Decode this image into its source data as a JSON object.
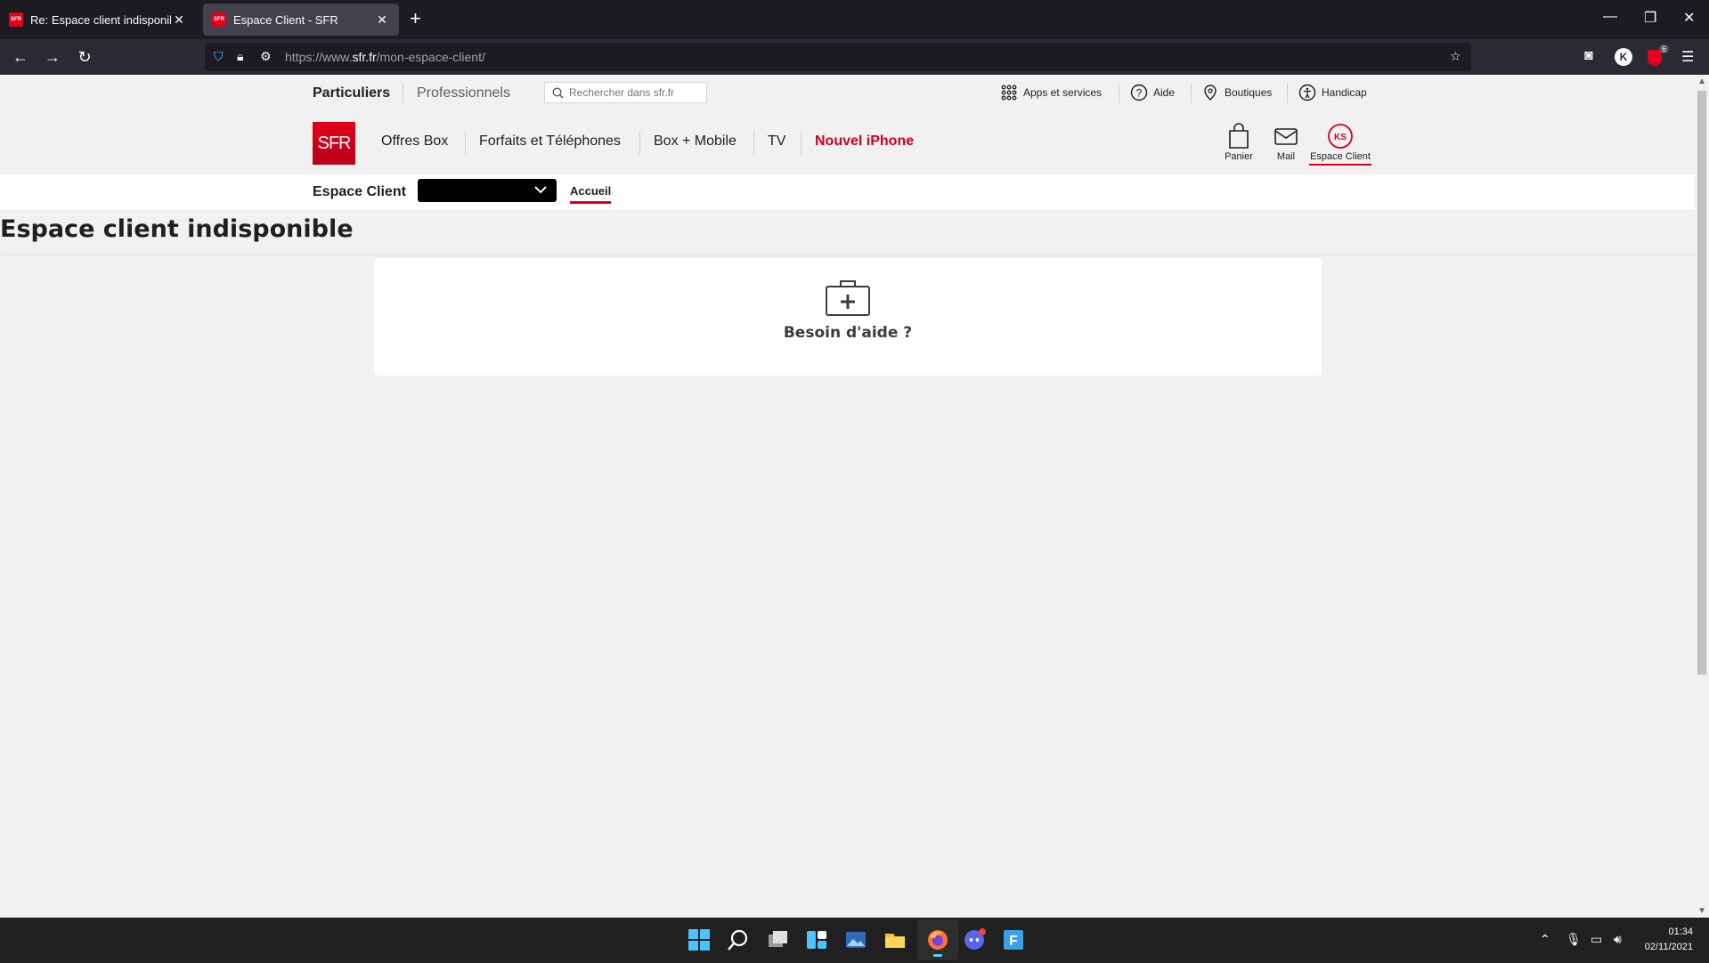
{
  "browser": {
    "tabs": [
      {
        "label": "Re: Espace client indisponible -",
        "favicon": "SFR"
      },
      {
        "label": "Espace Client - SFR",
        "favicon": "SFR"
      }
    ],
    "url_prefix": "https://www.",
    "url_domain": "sfr.fr",
    "url_path": "/mon-espace-client/",
    "profile_initial": "K",
    "extension_badge": "6"
  },
  "sfr": {
    "segments": {
      "particuliers": "Particuliers",
      "professionnels": "Professionnels"
    },
    "search_placeholder": "Rechercher dans sfr.fr",
    "top_links": {
      "apps": "Apps et services",
      "aide": "Aide",
      "boutiques": "Boutiques",
      "handicap": "Handicap"
    },
    "logo": "SFR",
    "main_nav": {
      "offres_box": "Offres Box",
      "forfaits": "Forfaits et Téléphones",
      "box_mobile": "Box + Mobile",
      "tv": "TV",
      "nouvel_iphone": "Nouvel iPhone"
    },
    "header_icons": {
      "panier": "Panier",
      "mail": "Mail",
      "espace_client": "Espace Client",
      "avatar_initials": "KS"
    },
    "espace_bar": {
      "title": "Espace Client",
      "accueil": "Accueil"
    },
    "error_title": "Espace client indisponible",
    "help_text": "Besoin d'aide ?",
    "colors": {
      "brand_red": "#e2001a",
      "accent_red": "#d3001f"
    }
  },
  "taskbar": {
    "time": "01:34",
    "date": "02/11/2021"
  }
}
